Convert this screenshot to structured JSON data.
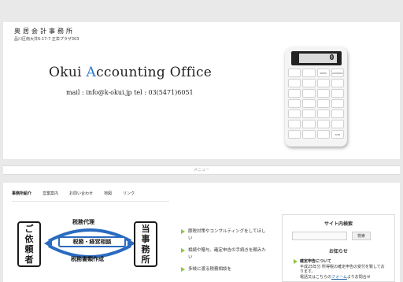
{
  "header": {
    "site_name": "奥居会計事務所",
    "address": "品川区南大井6-17-7 正栄プラザ303"
  },
  "banner": {
    "title_prefix": "Okui ",
    "title_accent": "A",
    "title_suffix": "ccounting Office",
    "contact": "mail : info@k-okui.jp     tel : 03(5471)6051",
    "accent_color": "#2a7bd1"
  },
  "calculator": {
    "display_value": "0",
    "keys": [
      "",
      "",
      "SEND",
      "BACKSPACE",
      "",
      "",
      "",
      "",
      "",
      "",
      "",
      "",
      "",
      "",
      "",
      "",
      "",
      "",
      "",
      "",
      "",
      "",
      "",
      "",
      "",
      "",
      "",
      "SUB"
    ]
  },
  "menu_strip": {
    "label": "メニュー"
  },
  "nav": {
    "items": [
      {
        "label": "事務所紹介",
        "active": true
      },
      {
        "label": "営業案内",
        "active": false
      },
      {
        "label": "お問い合わせ",
        "active": false
      },
      {
        "label": "地図",
        "active": false
      },
      {
        "label": "リンク",
        "active": false
      }
    ]
  },
  "diagram": {
    "client_chars": [
      "ご",
      "依",
      "頼",
      "者"
    ],
    "office_chars": [
      "当",
      "事",
      "務",
      "所"
    ],
    "service_top": "税務代理",
    "service_middle": "税務・経営相談",
    "service_bottom": "税務書類作成"
  },
  "features": [
    "節税対策やコンサルティングをしてほしい",
    "相続や贈与、確定申告の手続きを頼みたい",
    "多岐に渡る税務相談を"
  ],
  "sidebar": {
    "search_title": "サイト内検索",
    "search_value": "",
    "search_button": "検索",
    "notice_title": "お知らせ",
    "notice": {
      "heading": "確定申告について",
      "body": "平成25年分 所得税の確定申告の受付を致しております。",
      "contact_prefix": "電話又はこちらの",
      "link": "フォーム",
      "contact_suffix": "よりお問合せ"
    }
  }
}
